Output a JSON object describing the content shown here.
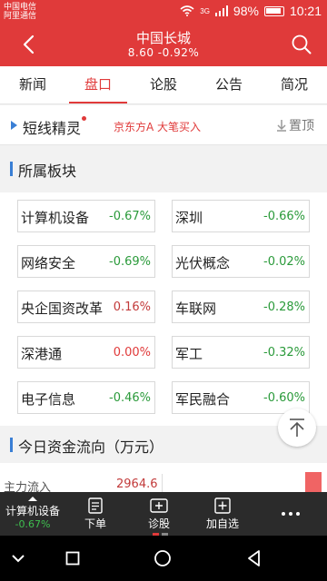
{
  "status": {
    "carrier_line1": "中国电信",
    "carrier_line2": "阿里通信",
    "network": "3G",
    "battery": "98%",
    "time": "10:21"
  },
  "header": {
    "title": "中国长城",
    "subtitle": "8.60  -0.92%"
  },
  "tabs": [
    {
      "label": "新闻"
    },
    {
      "label": "盘口"
    },
    {
      "label": "论股"
    },
    {
      "label": "公告"
    },
    {
      "label": "简况"
    }
  ],
  "shortline": {
    "title": "短线精灵",
    "info": "京东方A   大笔买入",
    "pin_label": "置顶"
  },
  "sectors": {
    "title": "所属板块",
    "items": [
      {
        "name": "计算机设备",
        "change": "-0.67%"
      },
      {
        "name": "深圳",
        "change": "-0.66%"
      },
      {
        "name": "网络安全",
        "change": "-0.69%"
      },
      {
        "name": "光伏概念",
        "change": "-0.02%"
      },
      {
        "name": "央企国资改革",
        "change": "0.16%"
      },
      {
        "name": "车联网",
        "change": "-0.28%"
      },
      {
        "name": "深港通",
        "change": "0.00%"
      },
      {
        "name": "军工",
        "change": "-0.32%"
      },
      {
        "name": "电子信息",
        "change": "-0.46%"
      },
      {
        "name": "军民融合",
        "change": "-0.60%"
      }
    ]
  },
  "fund_flow": {
    "title": "今日资金流向（万元）",
    "row_label": "主力流入",
    "row_value": "2964.6"
  },
  "bottom_bar": {
    "sector_name": "计算机设备",
    "sector_change": "-0.67%",
    "order_label": "下单",
    "diagnose_label": "诊股",
    "watchlist_label": "加自选"
  },
  "colors": {
    "accent": "#e03a3a",
    "down": "#2a9a3a",
    "up": "#c23a3a",
    "marker": "#3a7fd5"
  }
}
